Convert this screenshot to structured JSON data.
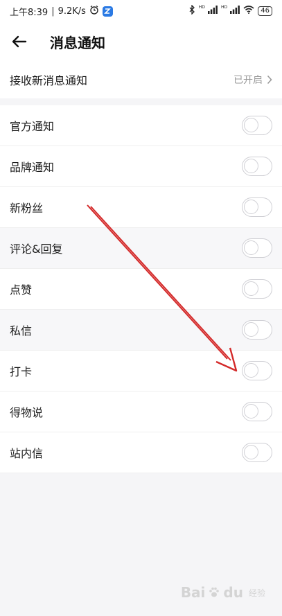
{
  "status_bar": {
    "time": "上午8:39",
    "separator": "|",
    "speed": "9.2K/s",
    "hd_1": "HD",
    "hd_2": "HD",
    "battery": "46"
  },
  "header": {
    "title": "消息通知"
  },
  "master": {
    "label": "接收新消息通知",
    "status": "已开启"
  },
  "items": [
    {
      "label": "官方通知",
      "enabled": false
    },
    {
      "label": "品牌通知",
      "enabled": false
    },
    {
      "label": "新粉丝",
      "enabled": false
    },
    {
      "label": "评论&回复",
      "enabled": false
    },
    {
      "label": "点赞",
      "enabled": false
    },
    {
      "label": "私信",
      "enabled": false
    },
    {
      "label": "打卡",
      "enabled": false
    },
    {
      "label": "得物说",
      "enabled": false
    },
    {
      "label": "站内信",
      "enabled": false
    }
  ],
  "watermark": {
    "text": "Bai",
    "text2": "du",
    "sub": "经验"
  },
  "colors": {
    "arrow": "#d42a2a",
    "background": "#f5f5f7"
  }
}
